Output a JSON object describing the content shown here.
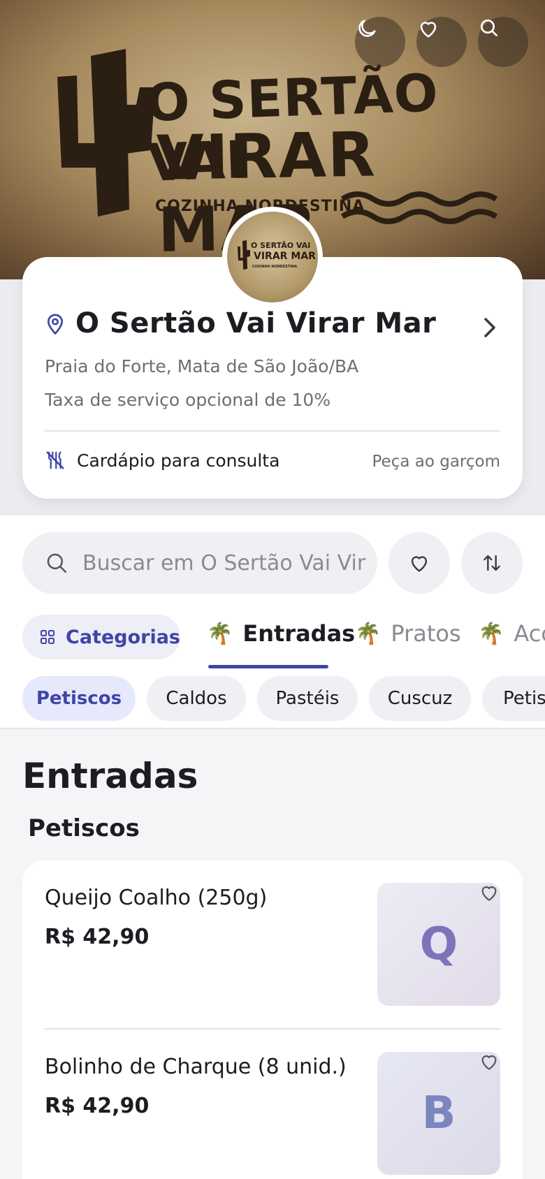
{
  "banner": {
    "line1": "O SERTÃO VAI",
    "line2": "VIRAR MAR",
    "line3": "COZINHA NORDESTINA"
  },
  "top_actions": [
    {
      "icon": "moon-icon"
    },
    {
      "icon": "heart-icon"
    },
    {
      "icon": "search-icon"
    }
  ],
  "logo": {
    "line1": "O SERTÃO VAI",
    "line2": "VIRAR MAR",
    "line3": "COZINHA NORDESTINA"
  },
  "restaurant": {
    "name": "O Sertão Vai Virar Mar",
    "address": "Praia do Forte, Mata de São João/BA",
    "service_fee": "Taxa de serviço opcional de 10%",
    "menu_mode": "Cardápio para consulta",
    "order_hint": "Peça ao garçom"
  },
  "search": {
    "placeholder": "Buscar em O Sertão Vai Vir"
  },
  "categories_button": "Categorias",
  "tabs": [
    {
      "emoji": "🌴",
      "label": "Entradas",
      "active": true
    },
    {
      "emoji": "🌴",
      "label": "Pratos",
      "active": false
    },
    {
      "emoji": "🌴",
      "label": "Acc",
      "active": false
    }
  ],
  "chips": [
    "Petiscos",
    "Caldos",
    "Pastéis",
    "Cuscuz",
    "Petis"
  ],
  "section": {
    "title": "Entradas",
    "subtitle": "Petiscos"
  },
  "items": [
    {
      "name": "Queijo Coalho (250g)",
      "price": "R$ 42,90",
      "initial": "Q"
    },
    {
      "name": "Bolinho de Charque (8 unid.)",
      "price": "R$ 42,90",
      "initial": "B"
    }
  ],
  "colors": {
    "accent": "#3f45a6",
    "text": "#1c1c22",
    "muted": "#6d6d74"
  }
}
